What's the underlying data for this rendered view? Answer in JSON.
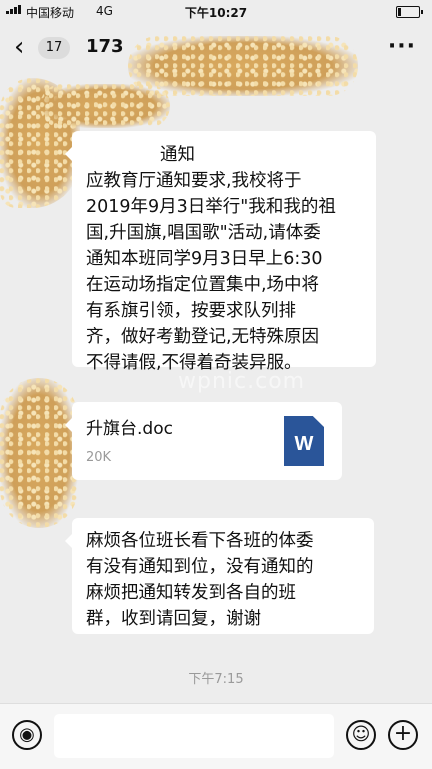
{
  "status_bar": {
    "carrier": "中国移动",
    "network": "4G",
    "time": "下午10:27",
    "battery_level": 0.15
  },
  "nav": {
    "back_icon": "chevron-left-icon",
    "unread_count": "17",
    "chat_title": "173",
    "more_icon": "more-icon"
  },
  "messages": {
    "notice": {
      "title": "通知",
      "lines": [
        "应教育厅通知要求,我校将于",
        "2019年9月3日举行\"我和我的祖",
        "国,升国旗,唱国歌\"活动,请体委",
        "通知本班同学9月3日早上6:30",
        "在运动场指定位置集中,场中将",
        "有系旗引领，按要求队列排",
        "齐，做好考勤登记,无特殊原因",
        "不得请假,不得着奇装异服。"
      ]
    },
    "file": {
      "name": "升旗台.doc",
      "size": "20K",
      "icon_letter": "W"
    },
    "reminder": {
      "lines": [
        "麻烦各位班长看下各班的体委",
        "有没有通知到位，没有通知的",
        "麻烦把通知转发到各自的班",
        "群，收到请回复，谢谢"
      ]
    }
  },
  "timestamp": "下午7:15",
  "watermark": "wpnic.com",
  "input_bar": {
    "voice_icon": "voice-icon",
    "emoji_icon": "emoji-icon",
    "plus_icon": "plus-icon",
    "voice_glyph": "◉",
    "emoji_glyph": "☺",
    "plus_glyph": "+"
  }
}
